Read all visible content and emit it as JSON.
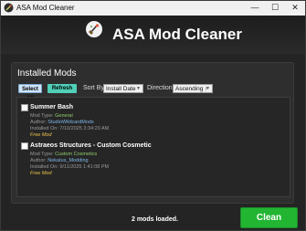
{
  "window": {
    "title": "ASA Mod Cleaner",
    "minimize": "—",
    "maximize": "☐",
    "close": "✕"
  },
  "header": {
    "title": "ASA Mod Cleaner"
  },
  "panel": {
    "title": "Installed Mods",
    "select_all_label": "Select All",
    "refresh_label": "Refresh",
    "sort_label": "Sort By:",
    "sort_value": "Install Date",
    "direction_label": "Direction:",
    "direction_value": "Ascending ↑"
  },
  "mods": [
    {
      "name": "Summer Bash",
      "type_label": "Mod Type:",
      "type_value": "General",
      "author_label": "Author:",
      "author_value": "StudioWildcardMods",
      "installed_label": "Installed On:",
      "installed_value": "7/10/2025 3:34:20 AM",
      "badge": "Free Mod"
    },
    {
      "name": "Astraeos Structures - Custom Cosmetic",
      "type_label": "Mod Type:",
      "type_value": "Custom Cosmetics",
      "author_label": "Author:",
      "author_value": "Nekatus_Modding",
      "installed_label": "Installed On:",
      "installed_value": "9/11/2025 1:41:08 PM",
      "badge": "Free Mod"
    }
  ],
  "footer": {
    "status": "2 mods loaded.",
    "clean_label": "Clean"
  },
  "colors": {
    "accent_green": "#22b532",
    "refresh_teal": "#50d0b8",
    "free_badge": "#e8c14e"
  }
}
